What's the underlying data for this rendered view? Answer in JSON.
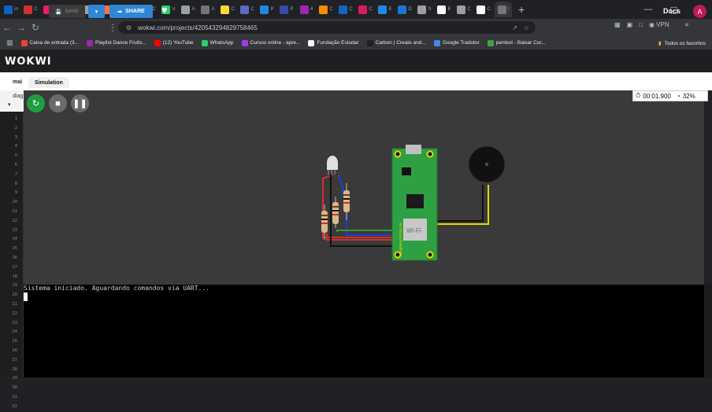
{
  "browser": {
    "tabs": [
      {
        "label": "in",
        "color": "#0a66c2"
      },
      {
        "label": "C",
        "color": "#d32f2f"
      },
      {
        "label": "C",
        "color": "#e91e63"
      },
      {
        "label": "L",
        "color": "#2e7d32"
      },
      {
        "label": "C",
        "color": "#9aa0a6"
      },
      {
        "label": "N",
        "color": "#ff7043"
      },
      {
        "label": "C",
        "color": "#fbc02d"
      },
      {
        "label": "C",
        "color": "#3949ab"
      },
      {
        "label": "V",
        "color": "#25d366"
      },
      {
        "label": "A",
        "color": "#9aa0a6"
      },
      {
        "label": "A",
        "color": "#757575"
      },
      {
        "label": "C",
        "color": "#fdd835"
      },
      {
        "label": "C",
        "color": "#5c6bc0"
      },
      {
        "label": "P",
        "color": "#1e88e5"
      },
      {
        "label": "P",
        "color": "#3949ab"
      },
      {
        "label": "4",
        "color": "#9c27b0"
      },
      {
        "label": "C",
        "color": "#fb8c00"
      },
      {
        "label": "C",
        "color": "#1565c0"
      },
      {
        "label": "C",
        "color": "#d81b60"
      },
      {
        "label": "E",
        "color": "#1e88e5"
      },
      {
        "label": "D",
        "color": "#1976d2"
      },
      {
        "label": "S",
        "color": "#9e9e9e"
      },
      {
        "label": "E",
        "color": "#ffffff"
      },
      {
        "label": "C",
        "color": "#9e9e9e"
      },
      {
        "label": "C",
        "color": "#ffffff"
      },
      {
        "label": "/",
        "color": "#757575"
      }
    ],
    "new_tab_label": "+",
    "window_controls": {
      "minimize": "—",
      "maximize": "▢",
      "close": "✕"
    },
    "url": "wokwi.com/projects/420543294829758465",
    "vpn_label": "VPN",
    "bookmarks": [
      {
        "label": "Caixa de entrada (3...",
        "color": "#ea4335"
      },
      {
        "label": "Playlist Dance Fruits...",
        "color": "#9c27b0"
      },
      {
        "label": "(12) YouTube",
        "color": "#ff0000"
      },
      {
        "label": "WhatsApp",
        "color": "#25d366"
      },
      {
        "label": "Cursos online - apre...",
        "color": "#a435f0"
      },
      {
        "label": "Fundação Estudar",
        "color": "#f5f5f5"
      },
      {
        "label": "Carbon | Create and...",
        "color": "#212121"
      },
      {
        "label": "Google Tradutor",
        "color": "#4285f4"
      },
      {
        "label": "pentest - Baixar Cur...",
        "color": "#43a047"
      }
    ],
    "all_bookmarks_label": "Todos os favoritos"
  },
  "wokwi": {
    "logo": "WOKWI",
    "save_label": "SAVE",
    "share_label": "SHARE",
    "docs_label": "Docs",
    "avatar_letter": "A",
    "editor_tab": "mai",
    "editor_sub": "diag",
    "simulation_tab": "Simulation",
    "timer": "00:01.900",
    "cpu": "32%"
  },
  "gutter_lines": [
    "1",
    "2",
    "3",
    "4",
    "5",
    "6",
    "7",
    "8",
    "9",
    "10",
    "11",
    "12",
    "13",
    "14",
    "15",
    "16",
    "17",
    "18",
    "19",
    "20",
    "21",
    "22",
    "23",
    "24",
    "25",
    "26",
    "27",
    "28",
    "29",
    "30",
    "31",
    "32"
  ],
  "serial": {
    "output": "Sistema iniciado. Aguardando comandos via UART..."
  },
  "circuit": {
    "board_label": "Raspberry Pi Pico W",
    "wifi_label": "Wi-Fi",
    "colors": {
      "board": "#2ea043",
      "wire_red": "#d32f2f",
      "wire_blue": "#1e3fd6",
      "wire_green": "#2e9e3a",
      "wire_black": "#111111",
      "wire_yellow": "#e6d800"
    }
  },
  "colors": {
    "share_blue": "#2f86d6",
    "restart_green": "#1e9e3e",
    "avatar": "#c2185b"
  }
}
